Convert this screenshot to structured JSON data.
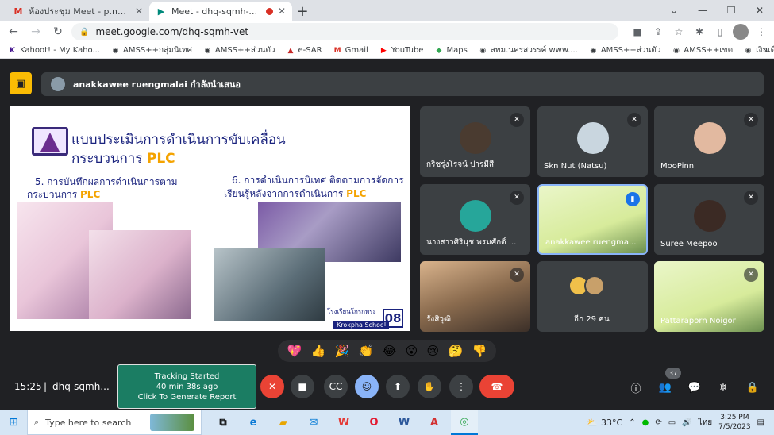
{
  "browser": {
    "tabs": [
      {
        "title": "ห้องประชุม Meet - p.noigor@gmai",
        "favicon": "gmail-icon"
      },
      {
        "title": "Meet - dhq-sqmh-vet",
        "favicon": "meet-icon",
        "active": true
      }
    ],
    "url": "meet.google.com/dhq-sqmh-vet",
    "bookmarks": [
      "Kahoot! - My Kaho...",
      "AMSS++กลุ่มนิเทศ",
      "AMSS++ส่วนตัว",
      "e-SAR",
      "Gmail",
      "YouTube",
      "Maps",
      "สพม.นครสวรรค์ www....",
      "AMSS++ส่วนตัว",
      "AMSS++เขต",
      "เงินเดือน"
    ]
  },
  "meet": {
    "presenter_text": "anakkawee ruengmalai กำลังนำเสนอ",
    "slide": {
      "title_line1": "แบบประเมินการดำเนินการขับเคลื่อน",
      "title_line2": "กระบวนการ",
      "title_highlight": "PLC",
      "item5_line1": "5. การบันทึกผลการดำเนินการตาม",
      "item5_line2": "กระบวนการ",
      "item6_line1": "6. การดำเนินการนิเทศ ติดตามการจัดการ",
      "item6_line2": "เรียนรู้หลังจากการดำเนินการ",
      "highlight": "PLC",
      "school_thai": "โรงเรียนโกรกพระ",
      "school_en": "Krokpha School",
      "slide_number": "08"
    },
    "participants": [
      {
        "name": "กริชรุ่งโรจน์ ปารมีสี",
        "muted": true
      },
      {
        "name": "Skn Nut (Natsu)",
        "muted": true
      },
      {
        "name": "MooPinn",
        "muted": true
      },
      {
        "name": "นางสาวศิรินุช พรมศักดิ์ ...",
        "muted": true
      },
      {
        "name": "anakkawee ruengma...",
        "speaking": true
      },
      {
        "name": "Suree Meepoo",
        "muted": true
      },
      {
        "name": "รังสิวุฒิ",
        "muted": true
      },
      {
        "name": "อีก 29 คน"
      },
      {
        "name": "Pattaraporn Noigor",
        "muted": true
      }
    ],
    "reactions": [
      "💖",
      "👍",
      "🎉",
      "👏",
      "😂",
      "😮",
      "😢",
      "🤔",
      "👎"
    ],
    "time": "15:25",
    "separator": "|",
    "meeting_code": "dhq-sqmh...",
    "tracking": {
      "line1": "Tracking Started",
      "line2": "40 min 38s ago",
      "line3": "Click To Generate Report"
    },
    "participant_count": "37"
  },
  "taskbar": {
    "search_placeholder": "Type here to search",
    "temperature": "33°C",
    "language": "ไทย",
    "time": "3:25 PM",
    "date": "7/5/2023"
  }
}
